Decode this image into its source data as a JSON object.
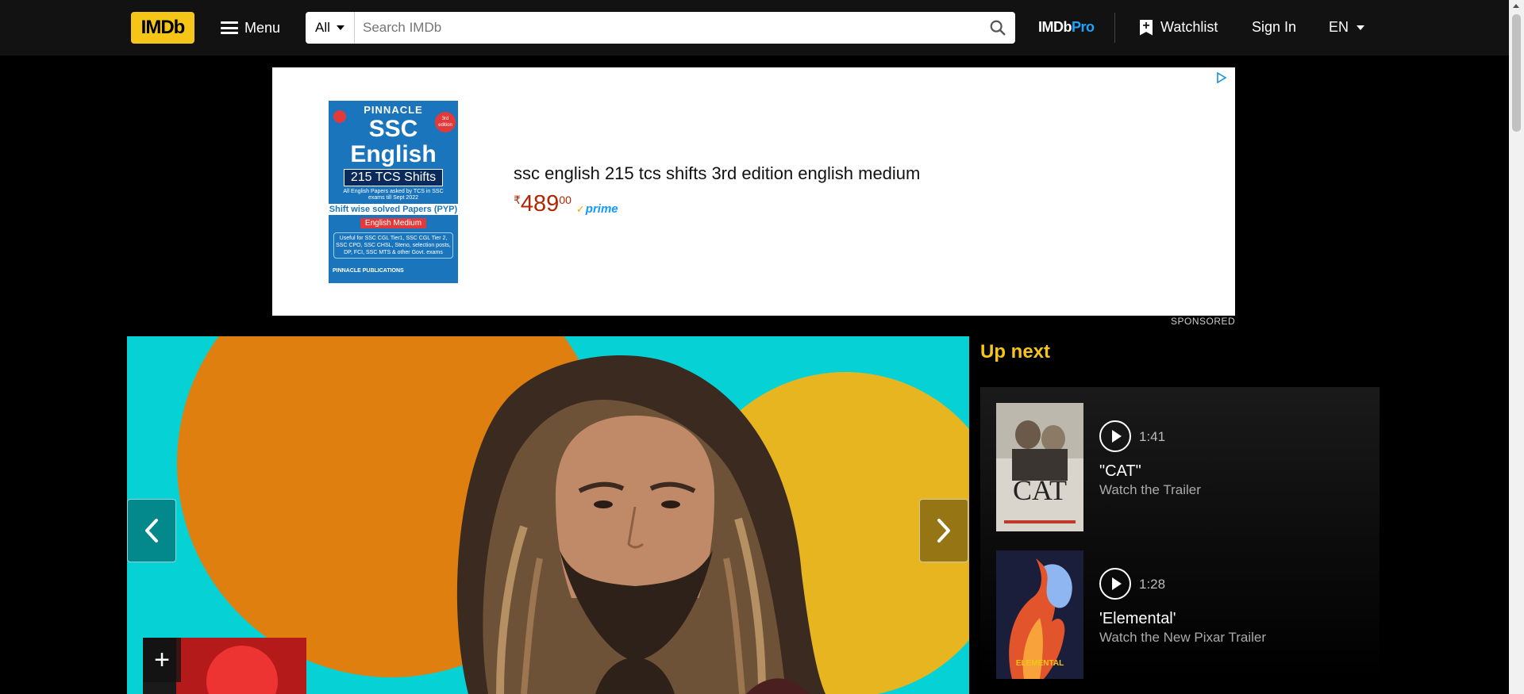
{
  "header": {
    "logo_text": "IMDb",
    "menu_label": "Menu",
    "search_category": "All",
    "search_placeholder": "Search IMDb",
    "imdbpro_a": "IMDb",
    "imdbpro_b": "Pro",
    "watchlist_label": "Watchlist",
    "signin_label": "Sign In",
    "language": "EN"
  },
  "ad": {
    "product_title": "ssc english 215 tcs shifts 3rd edition english medium",
    "price_currency": "₹",
    "price_whole": "489",
    "price_fraction": "00",
    "prime_label": "prime",
    "sponsored_label": "SPONSORED",
    "book": {
      "brand": "PINNACLE",
      "title_line1": "SSC",
      "title_line2": "English",
      "shifts": "215 TCS Shifts",
      "small_text": "All English Papers asked by TCS in SSC exams till Sept 2022",
      "solved": "Shift wise solved Papers (PYP)",
      "medium": "English Medium",
      "useful": "Useful for SSC CGL Tier1, SSC CGL Tier 2, SSC CPO, SSC CHSL, Steno, selection posts, DP, FCI, SSC MTS & other Govt. exams",
      "publisher": "PINNACLE PUBLICATIONS",
      "edition": "3rd edition"
    }
  },
  "upnext": {
    "title": "Up next",
    "items": [
      {
        "duration": "1:41",
        "title": "\"CAT\"",
        "subtitle": "Watch the Trailer",
        "poster_text": "CAT"
      },
      {
        "duration": "1:28",
        "title": "'Elemental'",
        "subtitle": "Watch the New Pixar Trailer",
        "poster_text": "ELEMENTAL"
      }
    ]
  },
  "colors": {
    "brand_yellow": "#f5c518",
    "hero_bg": "#06d2d6",
    "hero_orange": "#de7f10",
    "hero_yellow": "#e6b520",
    "imdbpro_blue": "#1ea4ff"
  }
}
